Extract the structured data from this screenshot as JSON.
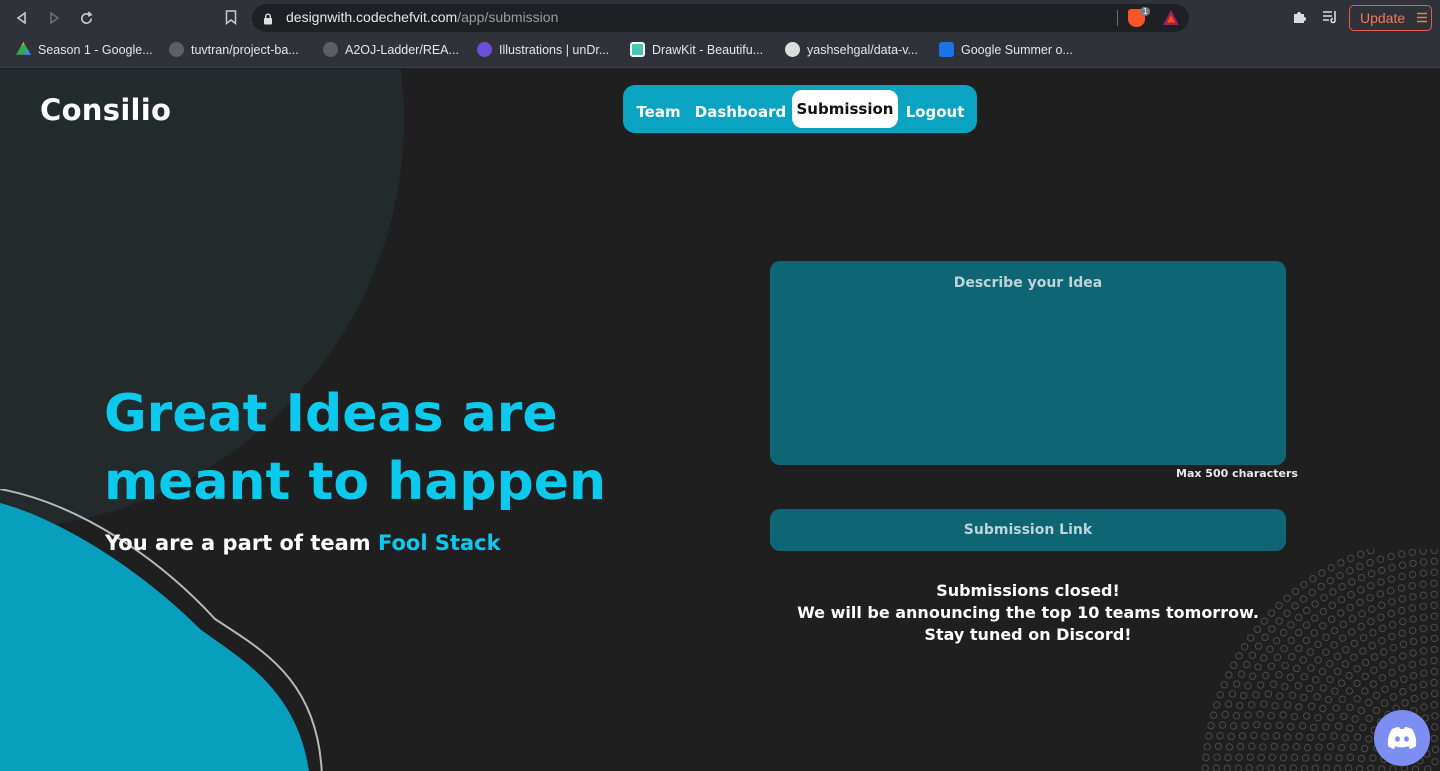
{
  "browser": {
    "url_host": "designwith.codechefvit.com",
    "url_path": "/app/submission",
    "brave_badge": "1",
    "update_label": "Update",
    "icons": {
      "back": "back-arrow-icon",
      "forward": "forward-arrow-icon",
      "reload": "reload-icon",
      "bookmark": "bookmark-icon",
      "lock": "lock-icon",
      "extensions": "puzzle-icon",
      "playlist": "playlist-icon",
      "menu": "hamburger-icon"
    }
  },
  "bookmarks": [
    {
      "label": "Season 1 - Google...",
      "icon": "google-drive-icon",
      "color": "#34a853"
    },
    {
      "label": "tuvtran/project-ba...",
      "icon": "github-icon",
      "color": "#5c5f66"
    },
    {
      "label": "A2OJ-Ladder/REA...",
      "icon": "github-icon",
      "color": "#5c5f66"
    },
    {
      "label": "Illustrations | unDr...",
      "icon": "undraw-icon",
      "color": "#6c4fd6"
    },
    {
      "label": "DrawKit - Beautifu...",
      "icon": "drawkit-icon",
      "color": "#48c6b2"
    },
    {
      "label": "yashsehgal/data-v...",
      "icon": "github-icon",
      "color": "#dddddd"
    },
    {
      "label": "Google Summer o...",
      "icon": "gsoc-icon",
      "color": "#1a73e8"
    }
  ],
  "site": {
    "logo": "Consilio",
    "nav": [
      {
        "label": "Team",
        "active": false
      },
      {
        "label": "Dashboard",
        "active": false
      },
      {
        "label": "Submission",
        "active": true
      },
      {
        "label": "Logout",
        "active": false
      }
    ],
    "headline": "Great Ideas are meant to happen",
    "team_prefix": "You are a part of team ",
    "team_name": "Fool Stack",
    "idea_placeholder": "Describe your Idea",
    "max_chars_note": "Max 500 characters",
    "link_placeholder": "Submission Link",
    "closed_lines": [
      "Submissions closed!",
      "We will be announcing the top 10 teams tomorrow.",
      "Stay tuned on Discord!"
    ],
    "discord_icon": "discord-icon"
  },
  "colors": {
    "accent": "#0ccaee",
    "nav_bg": "#0aa3c2",
    "input_bg": "#0e6573",
    "page_bg": "#1f1f1f",
    "discord": "#7c8ef2"
  }
}
